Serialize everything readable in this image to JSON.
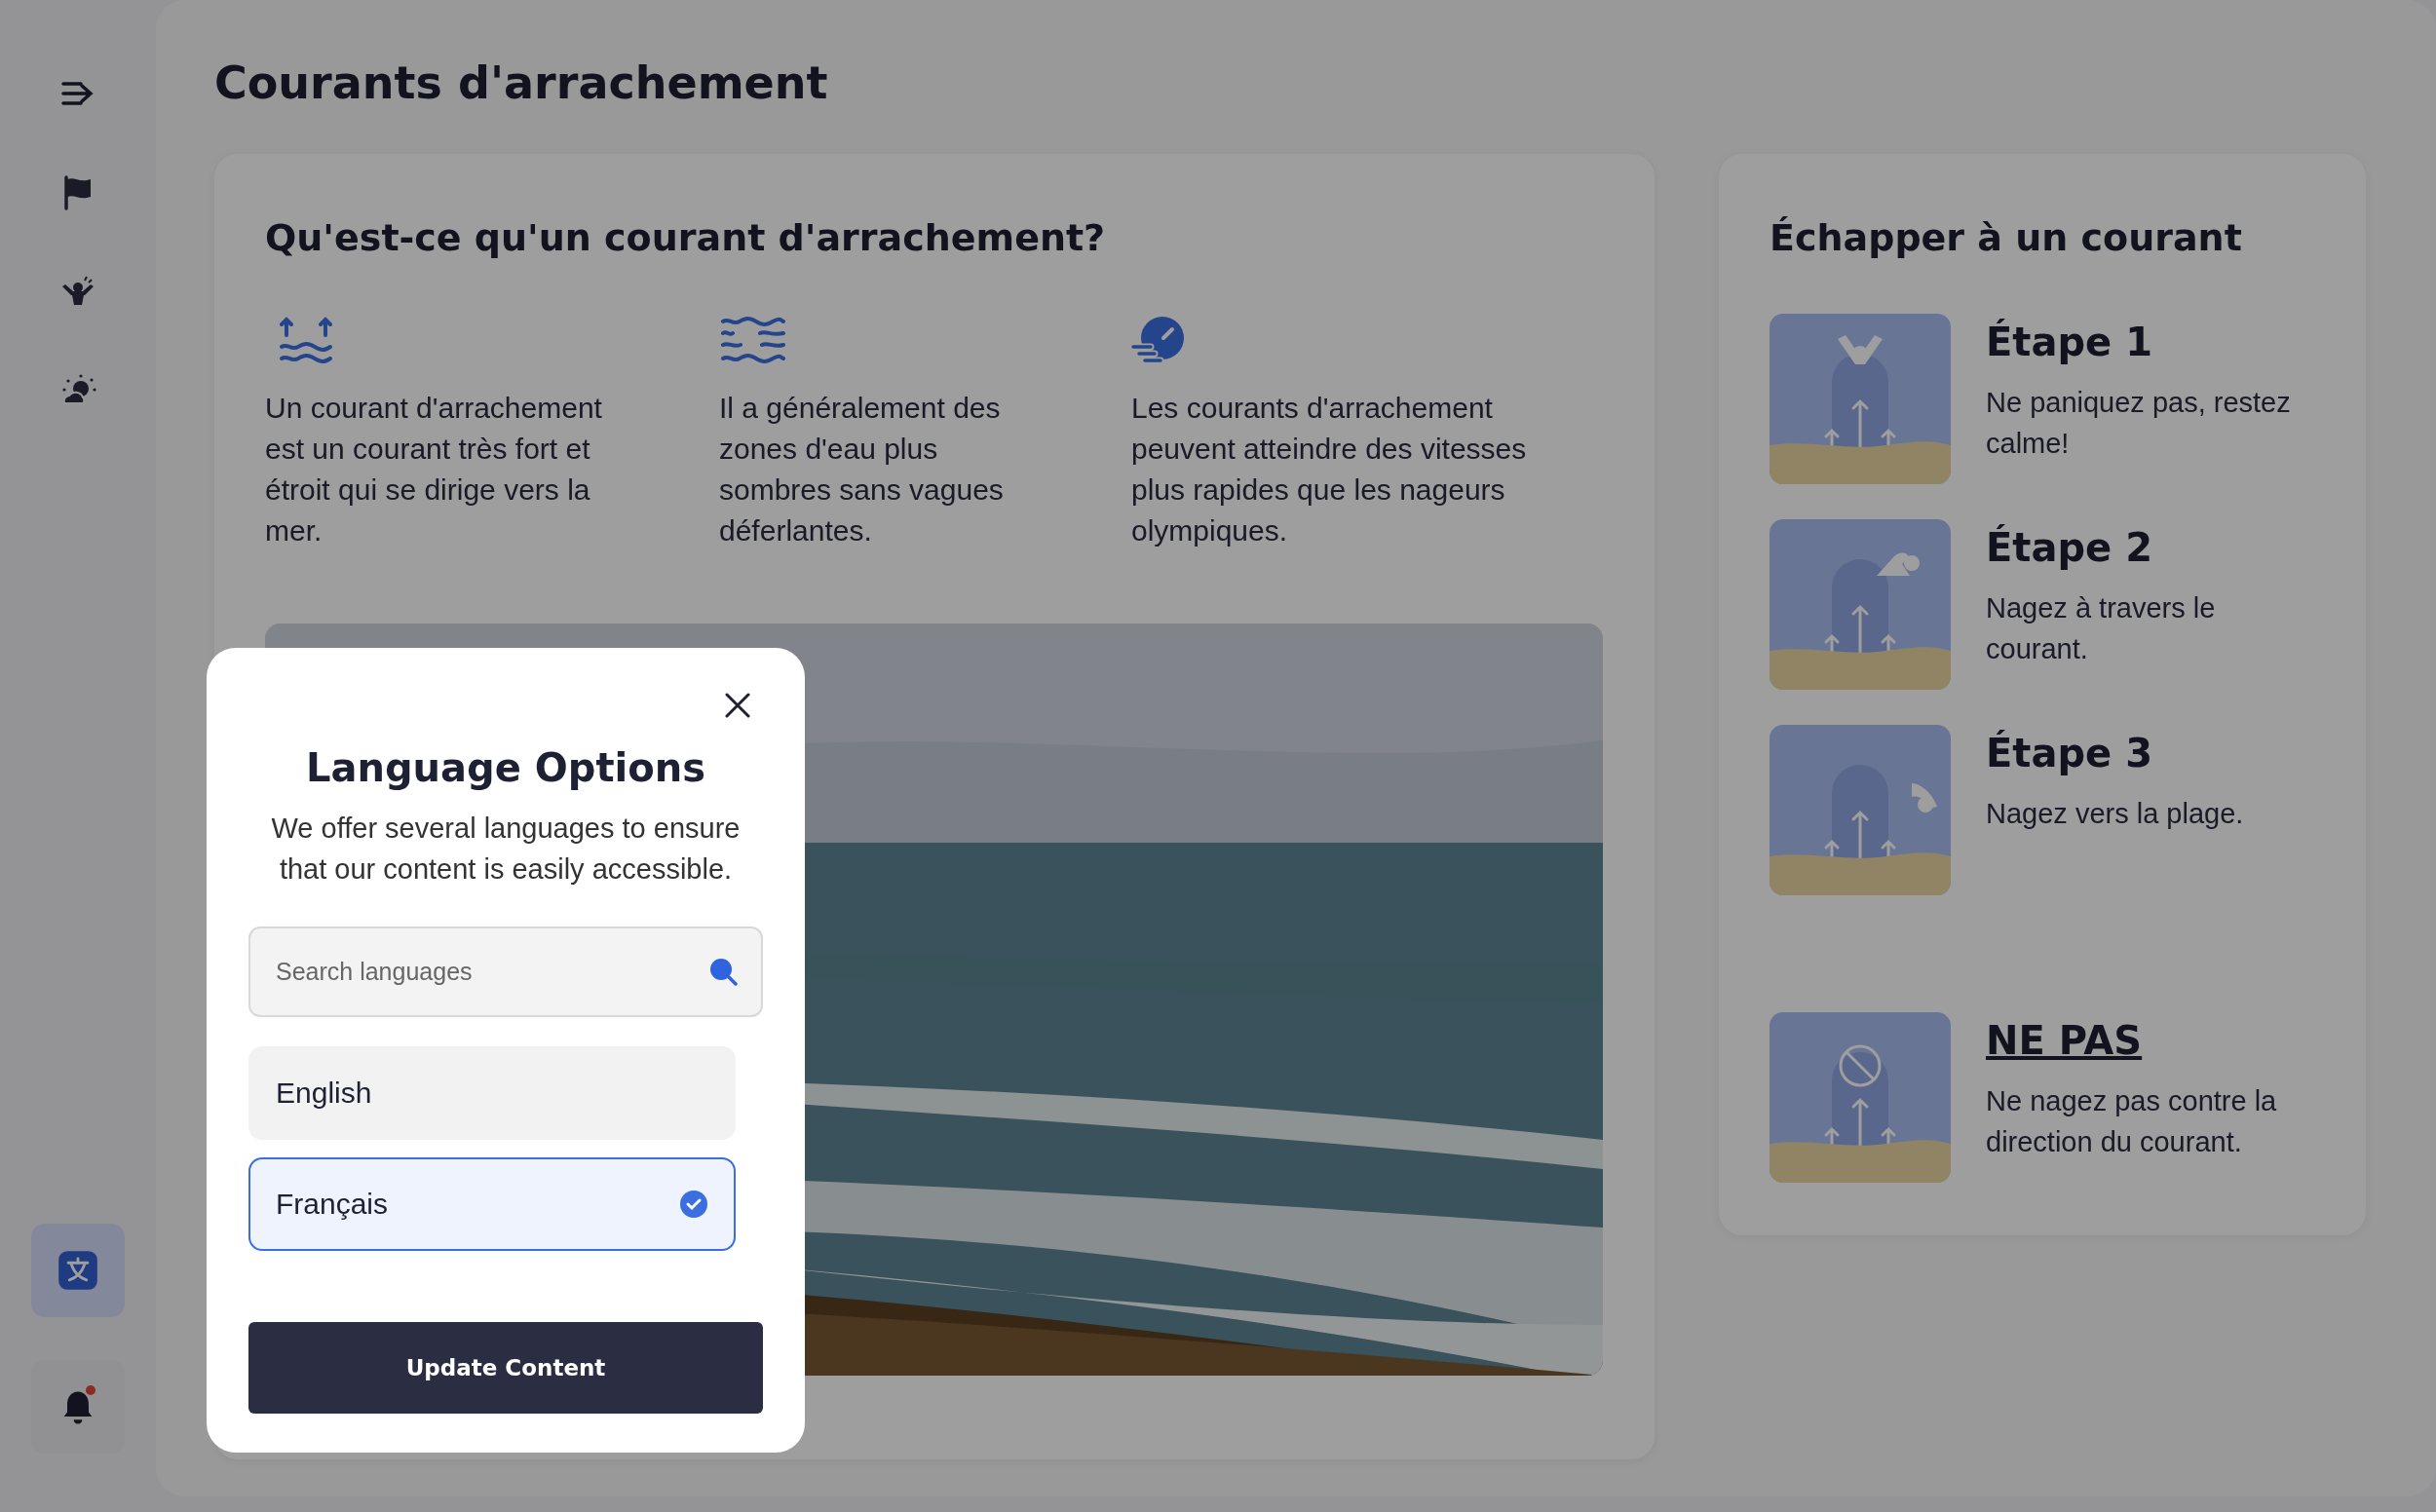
{
  "sidebar": {
    "bottom_items": [
      {
        "selected": true
      },
      {
        "selected": false,
        "notification": true
      }
    ]
  },
  "page": {
    "title": "Courants d'arrachement"
  },
  "intro_card": {
    "heading": "Qu'est-ce qu'un courant d'arrachement?",
    "facts": [
      {
        "text": "Un courant d'arrachement est un courant très fort et étroit qui se dirige vers la mer."
      },
      {
        "text": "Il a généralement des zones d'eau plus sombres sans vagues déferlantes."
      },
      {
        "text": "Les courants d'arrachement peuvent atteindre des vitesses plus rapides que les nageurs olympiques."
      }
    ]
  },
  "escape_card": {
    "heading": "Échapper à un courant",
    "steps": [
      {
        "kind": "step",
        "title": "Étape 1",
        "text": "Ne paniquez pas, restez calme!"
      },
      {
        "kind": "step",
        "title": "Étape 2",
        "text": "Nagez à travers le courant."
      },
      {
        "kind": "step",
        "title": "Étape 3",
        "text": "Nagez vers la plage."
      },
      {
        "kind": "warning",
        "title": "NE PAS",
        "text": "Ne nagez pas contre la direction du courant."
      }
    ]
  },
  "modal": {
    "title": "Language Options",
    "description": "We offer several languages to ensure that our content is easily accessible.",
    "search": {
      "placeholder": "Search languages"
    },
    "languages": [
      {
        "label": "English",
        "selected": false
      },
      {
        "label": "Français",
        "selected": true
      }
    ],
    "button": "Update Content"
  }
}
